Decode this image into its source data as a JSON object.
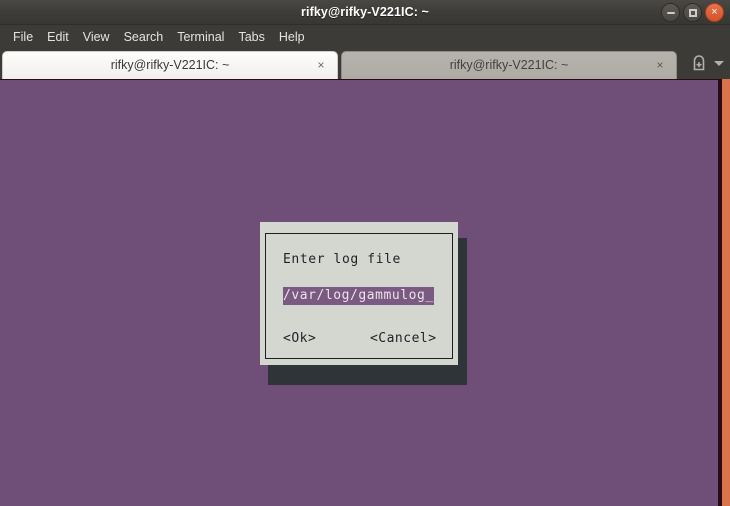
{
  "window": {
    "title": "rifky@rifky-V221IC: ~",
    "controls": [
      {
        "name": "minimize",
        "glyph": "minimize-icon"
      },
      {
        "name": "maximize",
        "glyph": "maximize-icon"
      },
      {
        "name": "close",
        "glyph": "×"
      }
    ]
  },
  "menubar": {
    "items": [
      {
        "label": "File"
      },
      {
        "label": "Edit"
      },
      {
        "label": "View"
      },
      {
        "label": "Search"
      },
      {
        "label": "Terminal"
      },
      {
        "label": "Tabs"
      },
      {
        "label": "Help"
      }
    ]
  },
  "tabbar": {
    "tabs": [
      {
        "label": "rifky@rifky-V221IC: ~",
        "close": "×",
        "active": true
      },
      {
        "label": "rifky@rifky-V221IC: ~",
        "close": "×",
        "active": false
      }
    ],
    "new_tab_icon": "new-tab-icon",
    "overflow_icon": "chevron-down-icon"
  },
  "terminal": {
    "background_color": "#6f4f77",
    "scrollbar_color": "#2a0b18",
    "edge_strip_color": "#d9734a"
  },
  "dialog": {
    "title": "Enter log file",
    "input_value": "/var/log/gammulog",
    "cursor": "_",
    "highlight_color": "#7b5a81",
    "background_color": "#d4d7d0",
    "buttons": [
      {
        "label": "<Ok>"
      },
      {
        "label": "<Cancel>"
      }
    ]
  }
}
